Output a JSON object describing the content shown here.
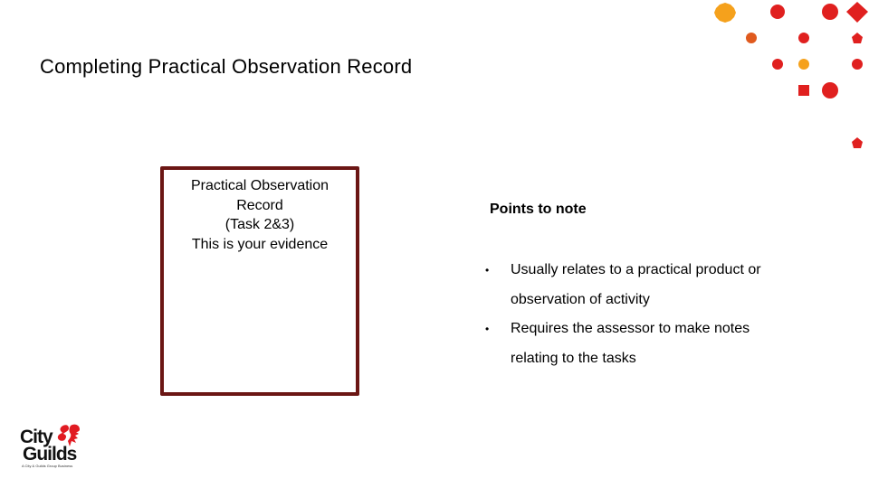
{
  "slide": {
    "title": "Completing Practical Observation Record"
  },
  "evidence_box": {
    "lines": [
      "Practical Observation",
      "Record",
      "(Task 2&3)",
      "This is your evidence"
    ],
    "border_color": "#6b1614"
  },
  "points": {
    "heading": "Points to note",
    "items": [
      "Usually relates to a practical product or observation of activity",
      "Requires the assessor to make notes relating to the tasks"
    ],
    "bullet": "•"
  },
  "logo": {
    "line1": "City",
    "line2": "Guilds",
    "tagline": "A City & Guilds Group Business",
    "icon": "lion-ampersand-icon",
    "accent_color": "#e11b22"
  },
  "decoration": {
    "colors": {
      "red": "#e0201f",
      "orange": "#f5a11c",
      "dark_orange": "#e05a1e"
    }
  }
}
